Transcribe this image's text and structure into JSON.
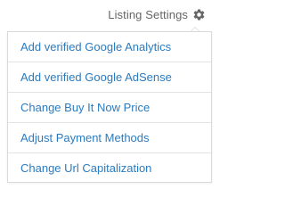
{
  "header": {
    "settings_label": "Listing Settings",
    "settings_icon": "gear-icon"
  },
  "menu": {
    "items": [
      {
        "label": "Add verified Google Analytics"
      },
      {
        "label": "Add verified Google AdSense"
      },
      {
        "label": "Change Buy It Now Price"
      },
      {
        "label": "Adjust Payment Methods"
      },
      {
        "label": "Change Url Capitalization"
      }
    ]
  },
  "colors": {
    "link": "#2b7bbf",
    "label": "#666666",
    "border": "#d9d9d9"
  }
}
